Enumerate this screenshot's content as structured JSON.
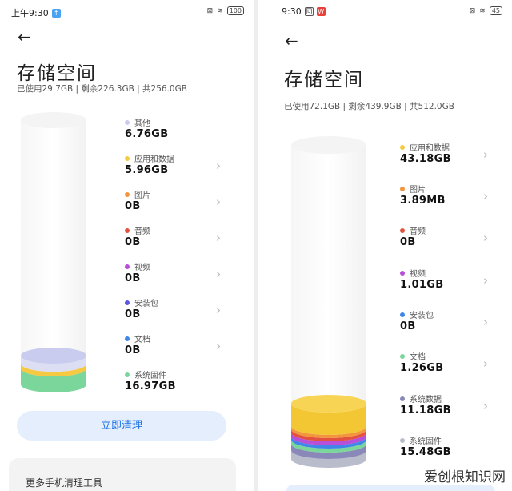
{
  "left": {
    "status": {
      "time": "上午9:30",
      "battery": "100"
    },
    "title": "存储空间",
    "summary": "已使用29.7GB | 剩余226.3GB | 共256.0GB",
    "categories": [
      {
        "label": "其他",
        "value": "6.76GB",
        "color": "#c9ccee",
        "chevron": false
      },
      {
        "label": "应用和数据",
        "value": "5.96GB",
        "color": "#f6c942",
        "chevron": true
      },
      {
        "label": "图片",
        "value": "0B",
        "color": "#f3943f",
        "chevron": true
      },
      {
        "label": "音频",
        "value": "0B",
        "color": "#e2523f",
        "chevron": true
      },
      {
        "label": "视频",
        "value": "0B",
        "color": "#b84fd8",
        "chevron": true
      },
      {
        "label": "安装包",
        "value": "0B",
        "color": "#5e55de",
        "chevron": true
      },
      {
        "label": "文档",
        "value": "0B",
        "color": "#3f86e8",
        "chevron": true
      },
      {
        "label": "系统固件",
        "value": "16.97GB",
        "color": "#7ad69a",
        "chevron": false
      }
    ],
    "clean_button": "立即清理",
    "more_tools": "更多手机清理工具"
  },
  "right": {
    "status": {
      "time": "9:30",
      "battery": "45"
    },
    "title": "存储空间",
    "summary": "已使用72.1GB | 剩余439.9GB | 共512.0GB",
    "categories": [
      {
        "label": "应用和数据",
        "value": "43.18GB",
        "color": "#f6c942",
        "chevron": true
      },
      {
        "label": "图片",
        "value": "3.89MB",
        "color": "#f3943f",
        "chevron": true
      },
      {
        "label": "音频",
        "value": "0B",
        "color": "#e2523f",
        "chevron": true
      },
      {
        "label": "视频",
        "value": "1.01GB",
        "color": "#b84fd8",
        "chevron": true
      },
      {
        "label": "安装包",
        "value": "0B",
        "color": "#3f86e8",
        "chevron": true
      },
      {
        "label": "文档",
        "value": "1.26GB",
        "color": "#7ad69a",
        "chevron": true
      },
      {
        "label": "系统数据",
        "value": "11.18GB",
        "color": "#8a88b8",
        "chevron": true
      },
      {
        "label": "系统固件",
        "value": "15.48GB",
        "color": "#b9bccb",
        "chevron": false
      }
    ]
  },
  "watermark": "爱创根知识网"
}
